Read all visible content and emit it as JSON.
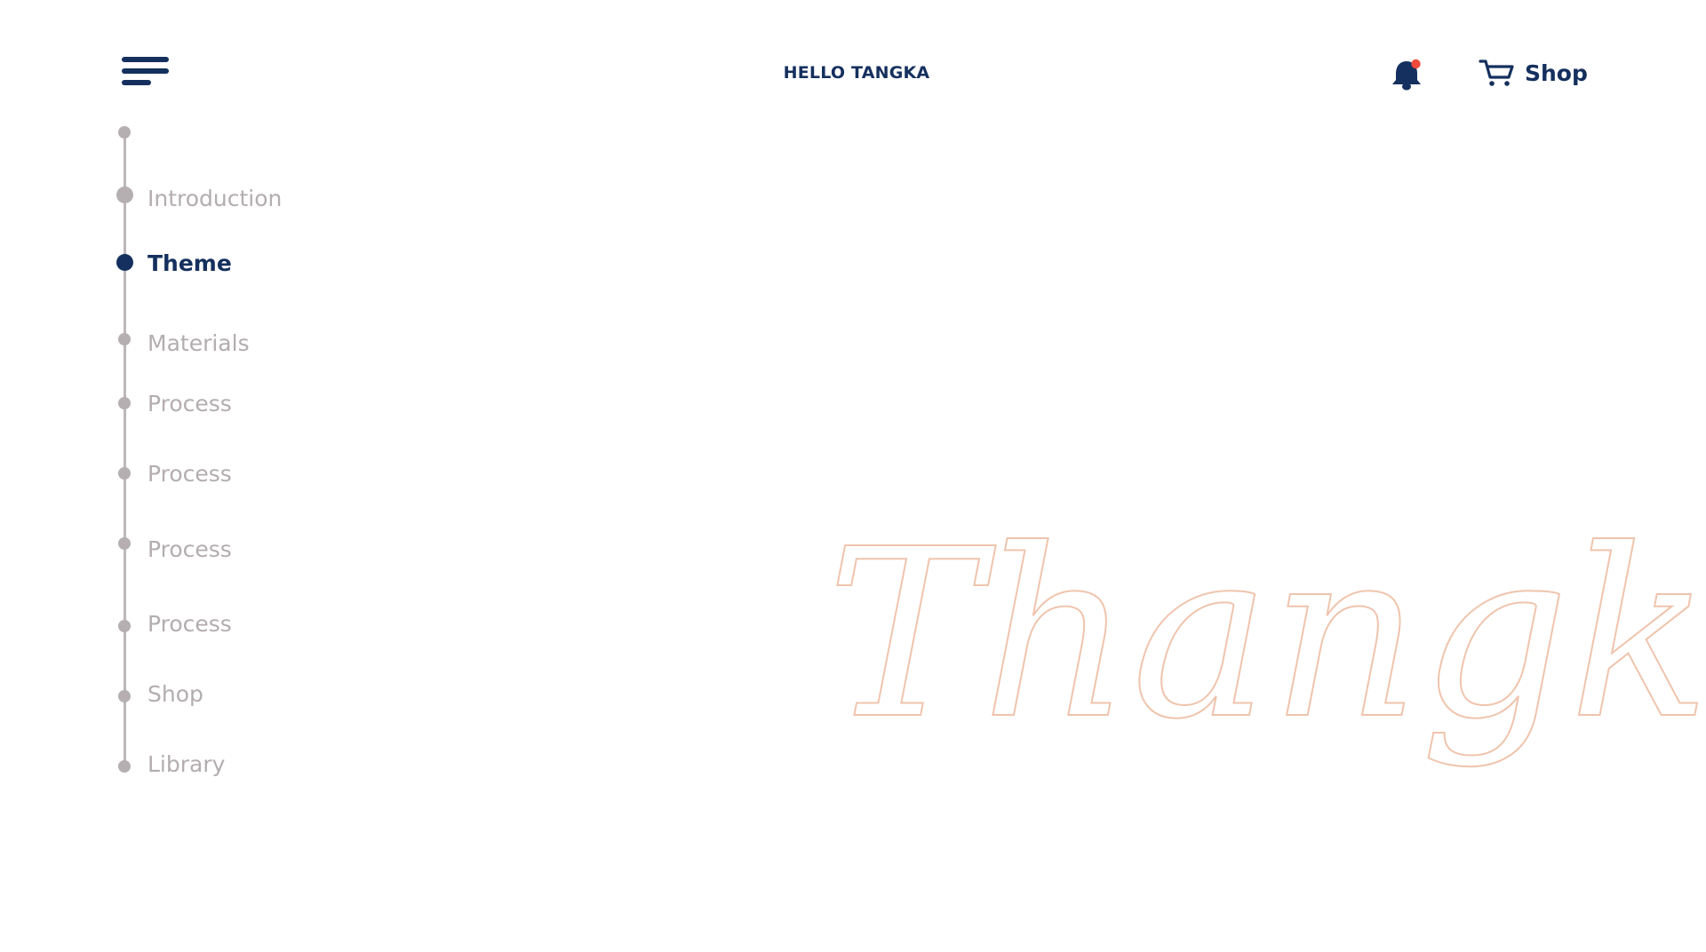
{
  "header": {
    "brand": "HELLO TANGKA",
    "shop_label": "Shop",
    "menu_icon": "hamburger-menu-icon",
    "bell_icon": "bell-icon",
    "cart_icon": "cart-icon",
    "notification_dot_color": "#f04a3c"
  },
  "nav": {
    "items": [
      {
        "label": "Introduction",
        "active": false
      },
      {
        "label": "Theme",
        "active": true
      },
      {
        "label": "Materials",
        "active": false
      },
      {
        "label": "Process",
        "active": false
      },
      {
        "label": "Process",
        "active": false
      },
      {
        "label": "Process",
        "active": false
      },
      {
        "label": "Process",
        "active": false
      },
      {
        "label": "Shop",
        "active": false
      },
      {
        "label": "Library",
        "active": false
      }
    ]
  },
  "hero": {
    "word": "Thangka",
    "outline_color": "#efc4ad"
  },
  "colors": {
    "primary": "#15305e",
    "muted": "#b3adb0",
    "background": "#ffffff"
  }
}
